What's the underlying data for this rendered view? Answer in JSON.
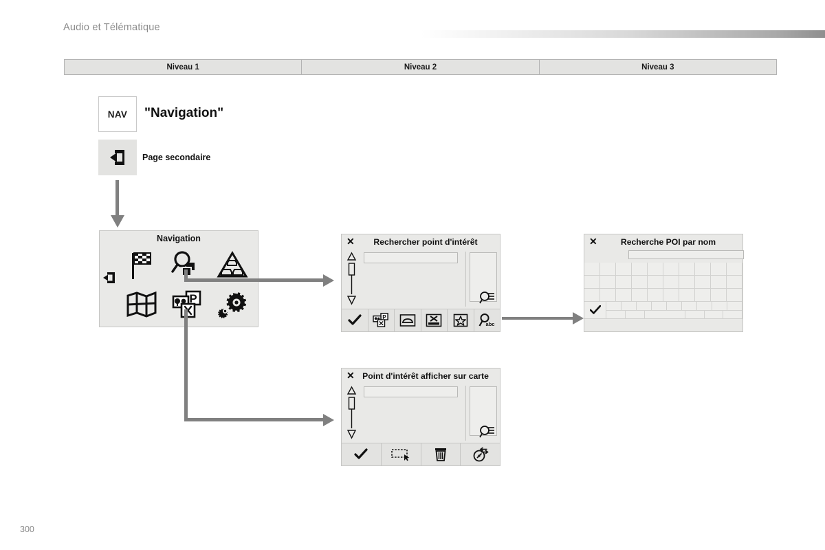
{
  "header": {
    "title": "Audio et Télématique",
    "page_number": "300"
  },
  "levels": {
    "columns": [
      "Niveau 1",
      "Niveau 2",
      "Niveau 3"
    ]
  },
  "legend": {
    "nav_badge": "NAV",
    "nav_label": "\"Navigation\"",
    "secondary_icon": "secondary-page-icon",
    "secondary_label": "Page secondaire"
  },
  "nav_screen": {
    "title": "Navigation",
    "back_icon": "exit-left-icon",
    "tiles": [
      {
        "name": "destination-flag-icon",
        "label": ""
      },
      {
        "name": "search-poi-icon",
        "label": ""
      },
      {
        "name": "traffic-icon",
        "label": ""
      },
      {
        "name": "map-icon",
        "label": ""
      },
      {
        "name": "poi-categories-icon",
        "label": ""
      },
      {
        "name": "settings-gear-icon",
        "label": ""
      }
    ]
  },
  "dialog_search_poi": {
    "close_icon": "close-icon",
    "title": "Rechercher point d'intérêt",
    "input_value": "",
    "list_hint_icon": "search-list-icon",
    "toolbar": [
      {
        "name": "confirm-check-icon"
      },
      {
        "name": "poi-categories-icon"
      },
      {
        "name": "car-icon"
      },
      {
        "name": "route-icon"
      },
      {
        "name": "favourite-star-icon"
      },
      {
        "name": "search-by-name-icon"
      }
    ]
  },
  "dialog_poi_by_name": {
    "close_icon": "close-icon",
    "title": "Recherche POI par nom",
    "input_value": "",
    "confirm_icon": "confirm-check-icon",
    "keyboard": {
      "rows": [
        10,
        10,
        10
      ],
      "bottom_row_keys": 9
    }
  },
  "dialog_poi_on_map": {
    "close_icon": "close-icon",
    "title": "Point d'intérêt afficher sur carte",
    "input_value": "",
    "list_hint_icon": "search-list-icon",
    "toolbar": [
      {
        "name": "confirm-check-icon"
      },
      {
        "name": "select-area-icon"
      },
      {
        "name": "delete-trash-icon"
      },
      {
        "name": "reset-compass-icon"
      }
    ]
  },
  "colors": {
    "connector": "#808080",
    "screen_bg": "#e9e9e7",
    "header_text": "#8a8a8a"
  }
}
